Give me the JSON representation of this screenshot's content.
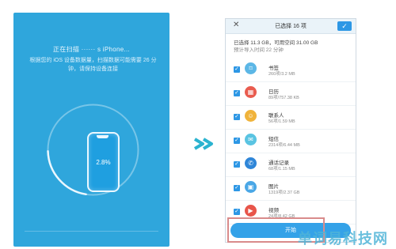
{
  "left_screen": {
    "title": "正在扫描 ······ s iPhone...",
    "subtitle": "根据您的 iOS 设备数据量，扫描数据可能需要 26 分钟，请保持设备连接",
    "progress_percent": "2.8%",
    "progress_fraction": 0.028
  },
  "right_screen": {
    "header": {
      "close_icon": "close-icon",
      "close_glyph": "✕",
      "title": "已选择 16 项",
      "confirm_icon": "check-icon",
      "confirm_glyph": "✓"
    },
    "summary": {
      "line1": "已选择 11.3 GB，可用空间 31.00 GB",
      "line2": "预计导入时间 22 分钟"
    },
    "items": [
      {
        "name": "书签",
        "size": "260项/3.2 MB",
        "icon": "bookmark-icon",
        "glyph": "⌑",
        "color": "#5cb7e6"
      },
      {
        "name": "日历",
        "size": "89项/757.38 KB",
        "icon": "calendar-icon",
        "glyph": "▦",
        "color": "#e95c4f"
      },
      {
        "name": "联系人",
        "size": "56项/1.59 MB",
        "icon": "contacts-icon",
        "glyph": "☺",
        "color": "#f0b33b"
      },
      {
        "name": "短信",
        "size": "2314项/6.44 MB",
        "icon": "message-icon",
        "glyph": "✉",
        "color": "#5ac4e2"
      },
      {
        "name": "通话记录",
        "size": "68项/1.15 MB",
        "icon": "phone-icon",
        "glyph": "✆",
        "color": "#2f86d8"
      },
      {
        "name": "图片",
        "size": "1319项/2.37 GB",
        "icon": "image-icon",
        "glyph": "▣",
        "color": "#4aa7e6"
      },
      {
        "name": "视频",
        "size": "24项/8.42 GB",
        "icon": "video-icon",
        "glyph": "▶",
        "color": "#e8554a"
      }
    ],
    "start_button": "开始"
  },
  "watermark": "单词易科技网",
  "colors": {
    "left_bg": "#2fa6dc",
    "accent": "#2d97e5",
    "arrow": "#2bb3d0"
  }
}
